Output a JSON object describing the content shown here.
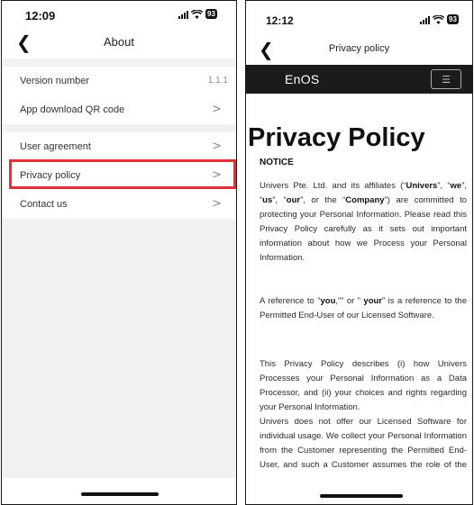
{
  "left_screen": {
    "status_bar": {
      "time": "12:09",
      "battery": "93"
    },
    "nav": {
      "back_icon": "chevron-left-icon",
      "title": "About"
    },
    "groups": [
      {
        "rows": [
          {
            "label": "Version number",
            "value": "1.1.1"
          },
          {
            "label": "App download QR code",
            "chevron": ">"
          }
        ]
      },
      {
        "rows": [
          {
            "label": "User agreement",
            "chevron": ">"
          },
          {
            "label": "Privacy policy",
            "chevron": ">",
            "highlighted": true
          },
          {
            "label": "Contact us",
            "chevron": ">"
          }
        ]
      }
    ],
    "highlight_color": "#e0303a"
  },
  "right_screen": {
    "status_bar": {
      "time": "12:12",
      "battery": "93"
    },
    "nav": {
      "back_icon": "chevron-left-icon",
      "title": "Privacy policy"
    },
    "site_header": {
      "logo": "EnOS",
      "menu_icon": "hamburger-menu-icon",
      "background": "#1b1b1b"
    },
    "document": {
      "title": "Privacy Policy",
      "notice": "NOTICE",
      "para1": {
        "t1": "Univers Pte. Ltd. and its affiliates (“",
        "b1": "Univers",
        "t2": "”, “",
        "b2": "we",
        "t3": "”, “",
        "b3": "us",
        "t4": "”, “",
        "b4": "our",
        "t5": "”, or the “",
        "b5": "Company",
        "t6": "”) are committed to protecting your Personal Information. Please read this Privacy Policy carefully as it sets out important information about how we Process your Personal Information."
      },
      "para2": {
        "t1": "A reference to “",
        "b1": "you",
        "t2": ",”” or ” ",
        "b2": "your",
        "t3": "” is a reference to the Permitted End-User of our Licensed Software."
      },
      "para3": "This Privacy Policy describes (i) how Univers Processes your Personal Information as a Data Processor, and (ii) your choices and rights regarding your Personal Information.",
      "para4": "Univers does not offer our Licensed Software for individual usage. We collect your Personal Information from the Customer representing the Permitted End-User, and such a Customer assumes the role of the Data Controller. As a"
    }
  }
}
